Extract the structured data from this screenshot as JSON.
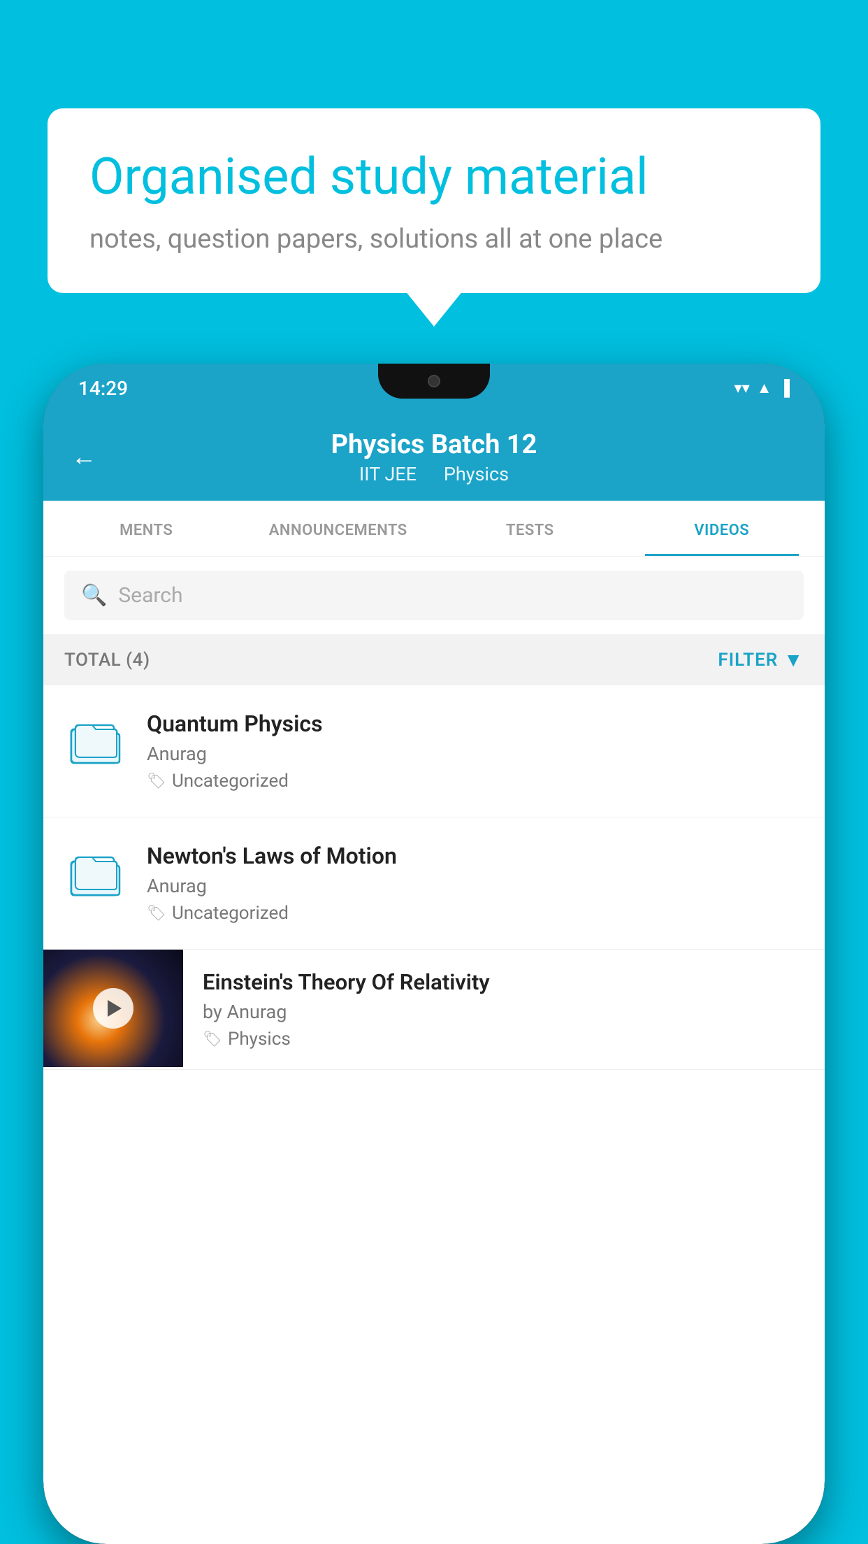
{
  "background_color": "#00BFDF",
  "bubble": {
    "title": "Organised study material",
    "subtitle": "notes, question papers, solutions all at one place"
  },
  "status_bar": {
    "time": "14:29",
    "icons": [
      "wifi",
      "signal",
      "battery"
    ]
  },
  "header": {
    "title": "Physics Batch 12",
    "subtitle1": "IIT JEE",
    "subtitle2": "Physics",
    "back_label": "←"
  },
  "tabs": [
    {
      "label": "MENTS",
      "active": false
    },
    {
      "label": "ANNOUNCEMENTS",
      "active": false
    },
    {
      "label": "TESTS",
      "active": false
    },
    {
      "label": "VIDEOS",
      "active": true
    }
  ],
  "search": {
    "placeholder": "Search"
  },
  "filter_bar": {
    "total_label": "TOTAL (4)",
    "filter_label": "FILTER"
  },
  "videos": [
    {
      "title": "Quantum Physics",
      "author": "Anurag",
      "tag": "Uncategorized",
      "has_thumbnail": false
    },
    {
      "title": "Newton's Laws of Motion",
      "author": "Anurag",
      "tag": "Uncategorized",
      "has_thumbnail": false
    },
    {
      "title": "Einstein's Theory Of Relativity",
      "author": "by Anurag",
      "tag": "Physics",
      "has_thumbnail": true
    }
  ]
}
